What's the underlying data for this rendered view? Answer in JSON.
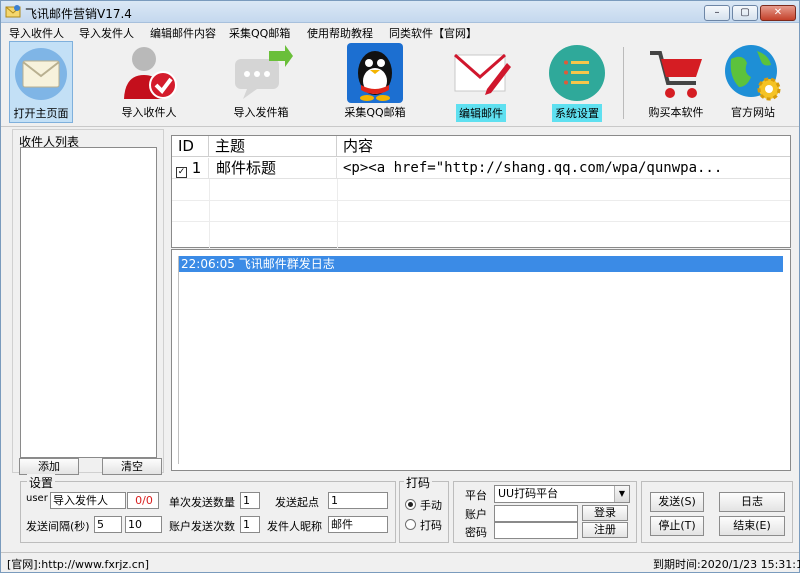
{
  "window": {
    "title": "飞讯邮件营销V17.4",
    "min_label": "–",
    "max_label": "▢",
    "close_label": "✕"
  },
  "menu": [
    "导入收件人",
    "导入发件人",
    "编辑邮件内容",
    "采集QQ邮箱",
    "使用帮助教程",
    "同类软件【官网】"
  ],
  "toolbar": {
    "home": "打开主页面",
    "import_recipients": "导入收件人",
    "import_senders": "导入发件箱",
    "collect_qq": "采集QQ邮箱",
    "edit_mail": "编辑邮件",
    "system_settings": "系统设置",
    "buy": "购买本软件",
    "official_site": "官方网站"
  },
  "recipients": {
    "caption": "收件人列表",
    "add_label": "添加",
    "clear_label": "清空"
  },
  "mail_grid": {
    "headers": [
      "ID",
      "主题",
      "内容"
    ],
    "rows": [
      {
        "checked": true,
        "id": "1",
        "subject": "邮件标题",
        "content": "<p><a href=\"http://shang.qq.com/wpa/qunwpa..."
      }
    ]
  },
  "log": {
    "entries": [
      "22:06:05 飞讯邮件群发日志"
    ]
  },
  "settings": {
    "caption": "设置",
    "user_label": "user",
    "import_sender_value": "导入发件人",
    "sender_count": "0/0",
    "single_send_label": "单次发送数量",
    "single_send_value": "1",
    "start_point_label": "发送起点",
    "start_point_value": "1",
    "interval_label": "发送间隔(秒)",
    "interval_min": "5",
    "interval_max": "10",
    "account_times_label": "账户发送次数",
    "account_times_value": "1",
    "nickname_label": "发件人昵称",
    "nickname_value": "邮件"
  },
  "captcha": {
    "caption": "打码",
    "manual_label": "手动",
    "auto_label": "打码",
    "selected": "manual"
  },
  "platform": {
    "label": "平台",
    "selected": "UU打码平台",
    "account_label": "账户",
    "password_label": "密码",
    "login_label": "登录",
    "register_label": "注册"
  },
  "actions": {
    "send": "发送(S)",
    "log": "日志",
    "stop": "停止(T)",
    "end": "结束(E)"
  },
  "status": {
    "website": "[官网]:http://www.fxrjz.cn]",
    "expiry": "到期时间:2020/1/23 15:31:18"
  },
  "colors": {
    "log_selection": "#3b8be6",
    "sender_count": "#d81e1e",
    "highlight_label": "#5fe0f0"
  }
}
